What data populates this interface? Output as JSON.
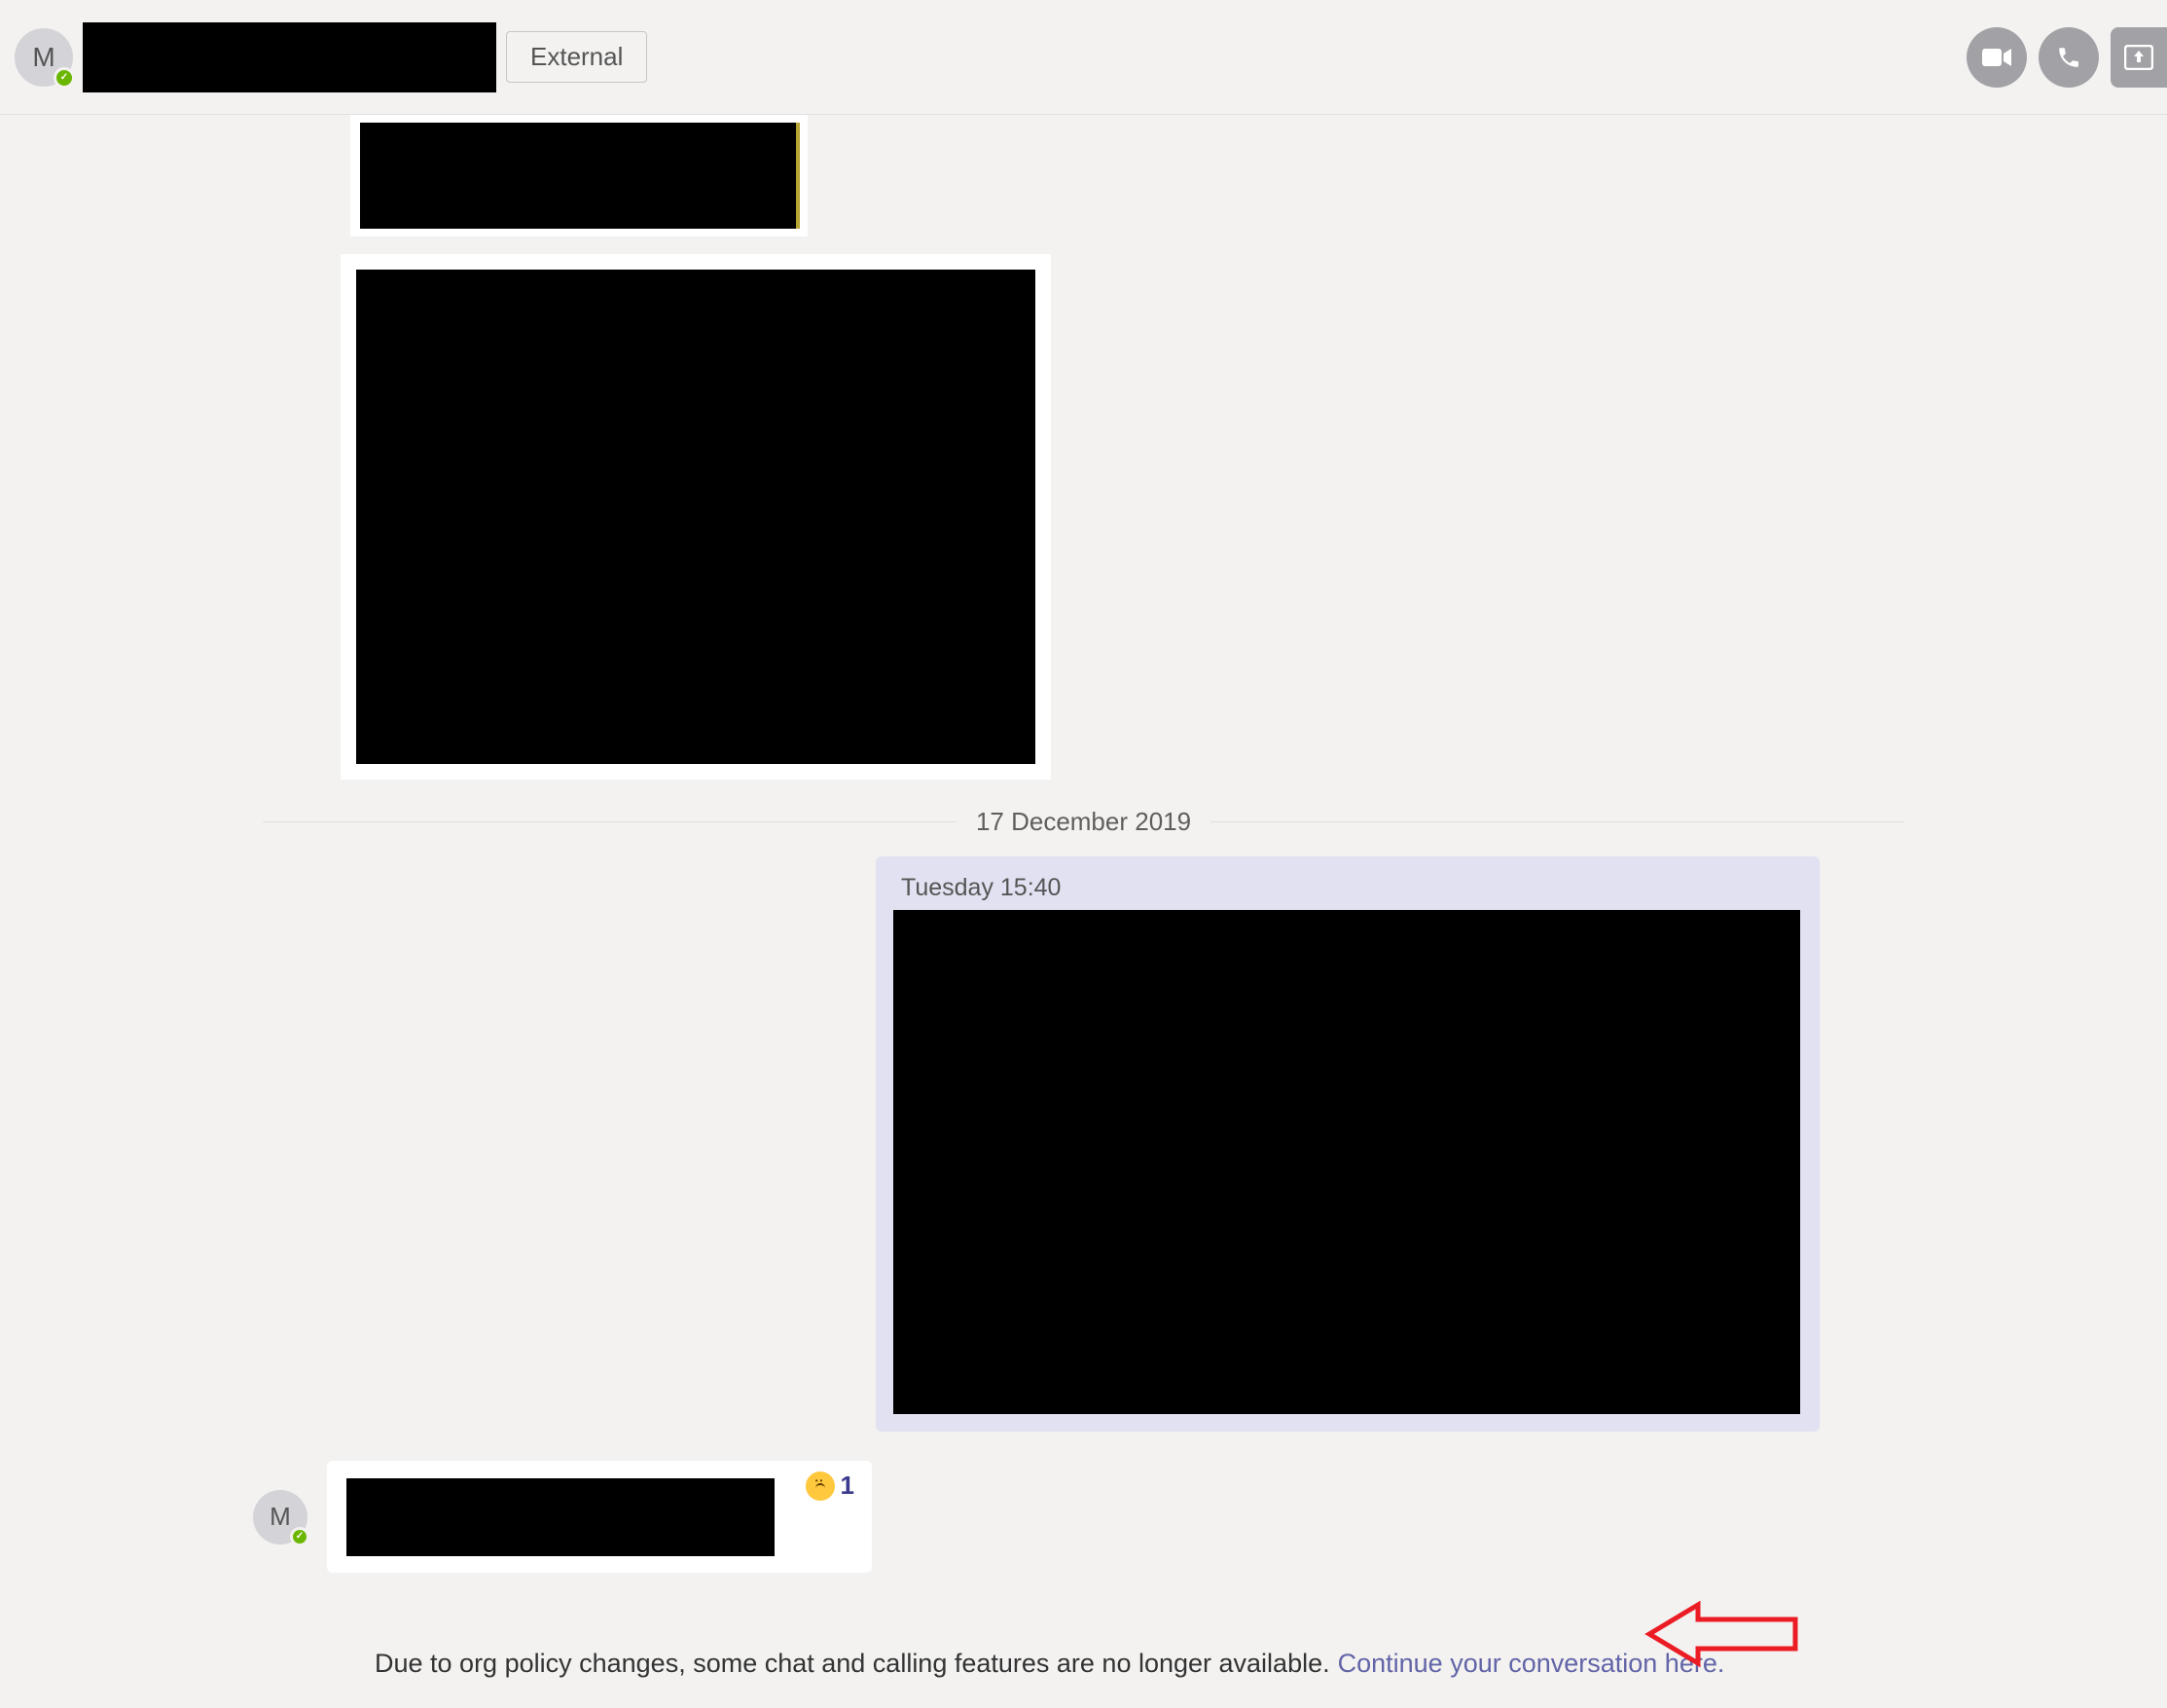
{
  "header": {
    "avatar_initial": "M",
    "external_label": "External"
  },
  "date_divider": "17 December 2019",
  "sent_message": {
    "timestamp": "Tuesday 15:40"
  },
  "received_row": {
    "avatar_initial": "M",
    "reaction_count": "1"
  },
  "policy": {
    "text": "Due to org policy changes, some chat and calling features are no longer available.",
    "link_text": "Continue your conversation here."
  }
}
